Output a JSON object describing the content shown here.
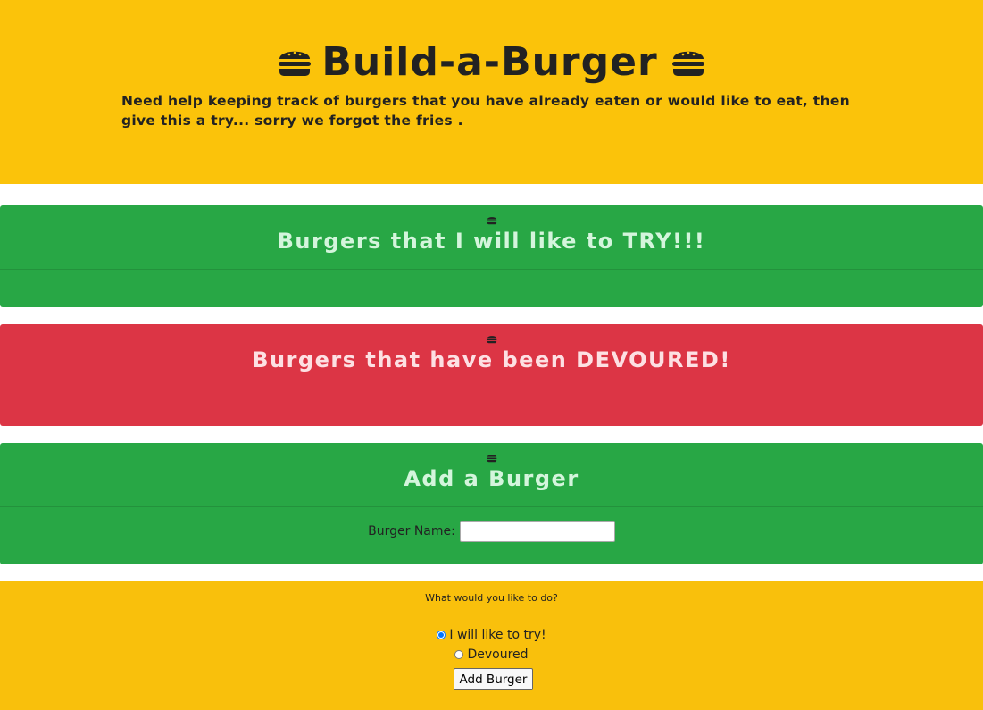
{
  "header": {
    "title": "Build-a-Burger",
    "tagline": "Need help keeping track of burgers that you have already eaten or would like to eat, then give this a try... sorry we forgot the fries ."
  },
  "sections": {
    "try": {
      "title": "Burgers that I will like to TRY!!!"
    },
    "devoured": {
      "title": "Burgers that have been DEVOURED!"
    },
    "add": {
      "title": "Add a Burger"
    }
  },
  "form": {
    "burger_name_label": "Burger Name:",
    "burger_name_value": "",
    "question": "What would you like to do?",
    "options": [
      {
        "label": "I will like to try!",
        "checked": true
      },
      {
        "label": "Devoured",
        "checked": false
      }
    ],
    "submit_label": "Add Burger"
  },
  "colors": {
    "header_bg": "#fbc30a",
    "green": "#28a745",
    "red": "#dc3545",
    "options_bg": "#f9c00c"
  },
  "icons": {
    "burger": "hamburger-icon"
  }
}
